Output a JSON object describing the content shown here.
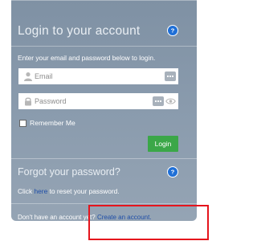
{
  "login": {
    "title": "Login to your account",
    "subtitle": "Enter your email and password below to login.",
    "email_placeholder": "Email",
    "password_placeholder": "Password",
    "remember_label": "Remember Me",
    "login_button": "Login"
  },
  "forgot": {
    "title": "Forgot your password?",
    "text_before": "Click ",
    "link": "here",
    "text_after": " to reset your password."
  },
  "signup": {
    "text": "Don't have an account yet? ",
    "link": "Create an account."
  },
  "icons": {
    "help": "help-icon",
    "user": "user-icon",
    "lock": "lock-icon",
    "dots": "dots-menu-icon",
    "eye": "eye-icon"
  },
  "colors": {
    "panel": "#8b9cae",
    "login_button": "#3ba748",
    "help_icon": "#1f6fd6",
    "link": "#1f4fa8",
    "highlight": "#e5141c"
  }
}
